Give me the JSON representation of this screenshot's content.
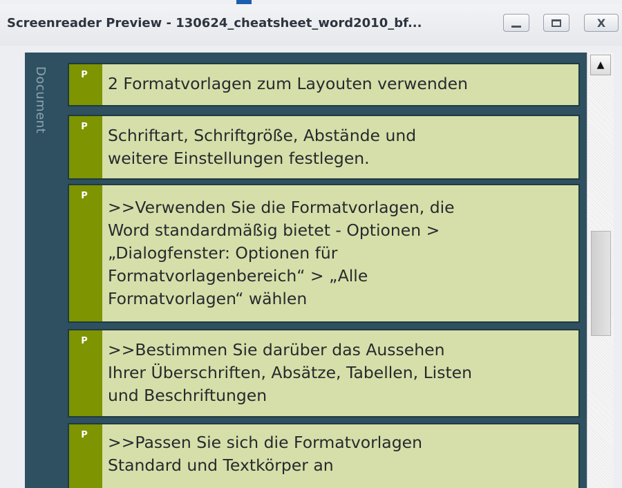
{
  "window": {
    "title": "Screenreader Preview - 130624_cheatsheet_word2010_bf...",
    "minimize_label": "",
    "maximize_label": "",
    "close_label": "X"
  },
  "sidebar": {
    "label": "Document"
  },
  "paragraphs": [
    {
      "tag": "P",
      "text": "2 Formatvorlagen zum Layouten verwenden"
    },
    {
      "tag": "P",
      "text": "Schriftart, Schriftgröße, Abstände und\nweitere Einstellungen festlegen."
    },
    {
      "tag": "P",
      "text": ">>Verwenden Sie die Formatvorlagen, die\nWord standardmäßig bietet - Optionen >\n„Dialogfenster: Optionen für\nFormatvorlagenbereich“ > „Alle\nFormatvorlagen“ wählen"
    },
    {
      "tag": "P",
      "text": ">>Bestimmen Sie darüber das Aussehen\nIhrer Überschriften, Absätze, Tabellen, Listen\nund Beschriftungen"
    },
    {
      "tag": "P",
      "text": ">>Passen Sie sich die Formatvorlagen\nStandard und Textkörper an"
    }
  ],
  "scrollbar": {
    "up_arrow_icon": "triangle-up-icon"
  }
}
